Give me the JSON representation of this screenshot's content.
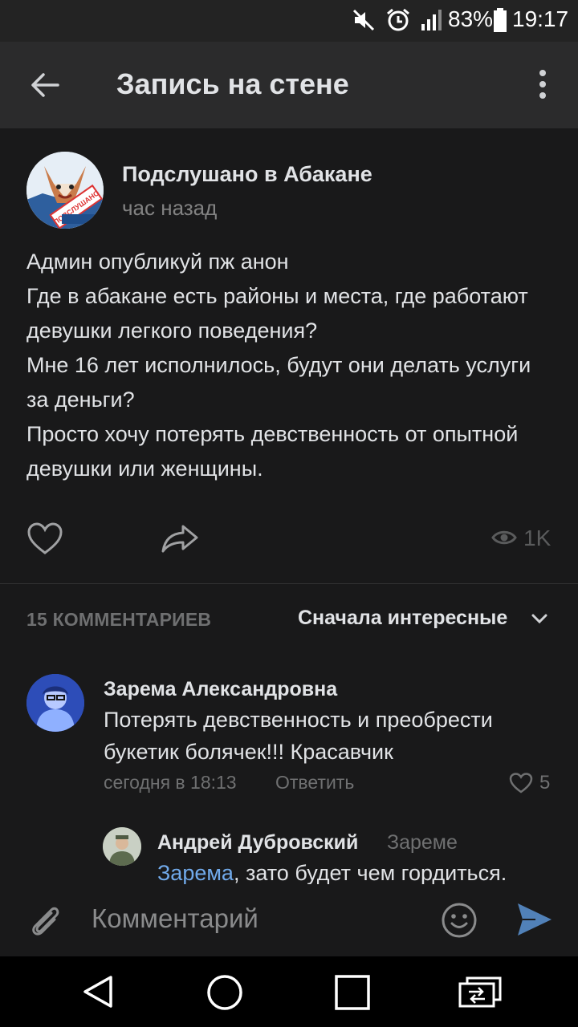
{
  "status_bar": {
    "battery": "83%",
    "time": "19:17",
    "icons": [
      "mute-icon",
      "alarm-icon",
      "signal-icon",
      "battery-icon"
    ]
  },
  "header": {
    "title": "Запись на стене",
    "back_icon": "arrow-left-icon",
    "menu_icon": "more-vertical-icon"
  },
  "post": {
    "author": "Подслушано в Абакане",
    "time": "час назад",
    "text": "Админ опубликуй пж анон\nГде в абакане есть районы и места, где работают девушки легкого поведения?\nМне 16 лет исполнилось, будут они делать услуги за деньги?\nПросто хочу потерять девственность от опытной девушки или женщины.",
    "avatar_text": "ПОДСЛУШАНО В АБАКАНЕ",
    "views": "1K"
  },
  "comments_section": {
    "count_label": "15 КОММЕНТАРИЕВ",
    "sort_label": "Сначала интересные"
  },
  "comments": [
    {
      "author": "Зарема Александровна",
      "text": "Потерять девственность и преобрести букетик болячек!!! Красавчик",
      "time": "сегодня в 18:13",
      "reply_label": "Ответить",
      "likes": "5"
    },
    {
      "author": "Андрей Дубровский",
      "reply_to": "Зареме",
      "mention": "Зарема",
      "text": ", зато будет чем гордиться."
    }
  ],
  "input": {
    "placeholder": "Комментарий"
  },
  "colors": {
    "background": "#19191a",
    "header": "#2b2b2c",
    "accent": "#71aaeb",
    "send": "#5181b8"
  }
}
